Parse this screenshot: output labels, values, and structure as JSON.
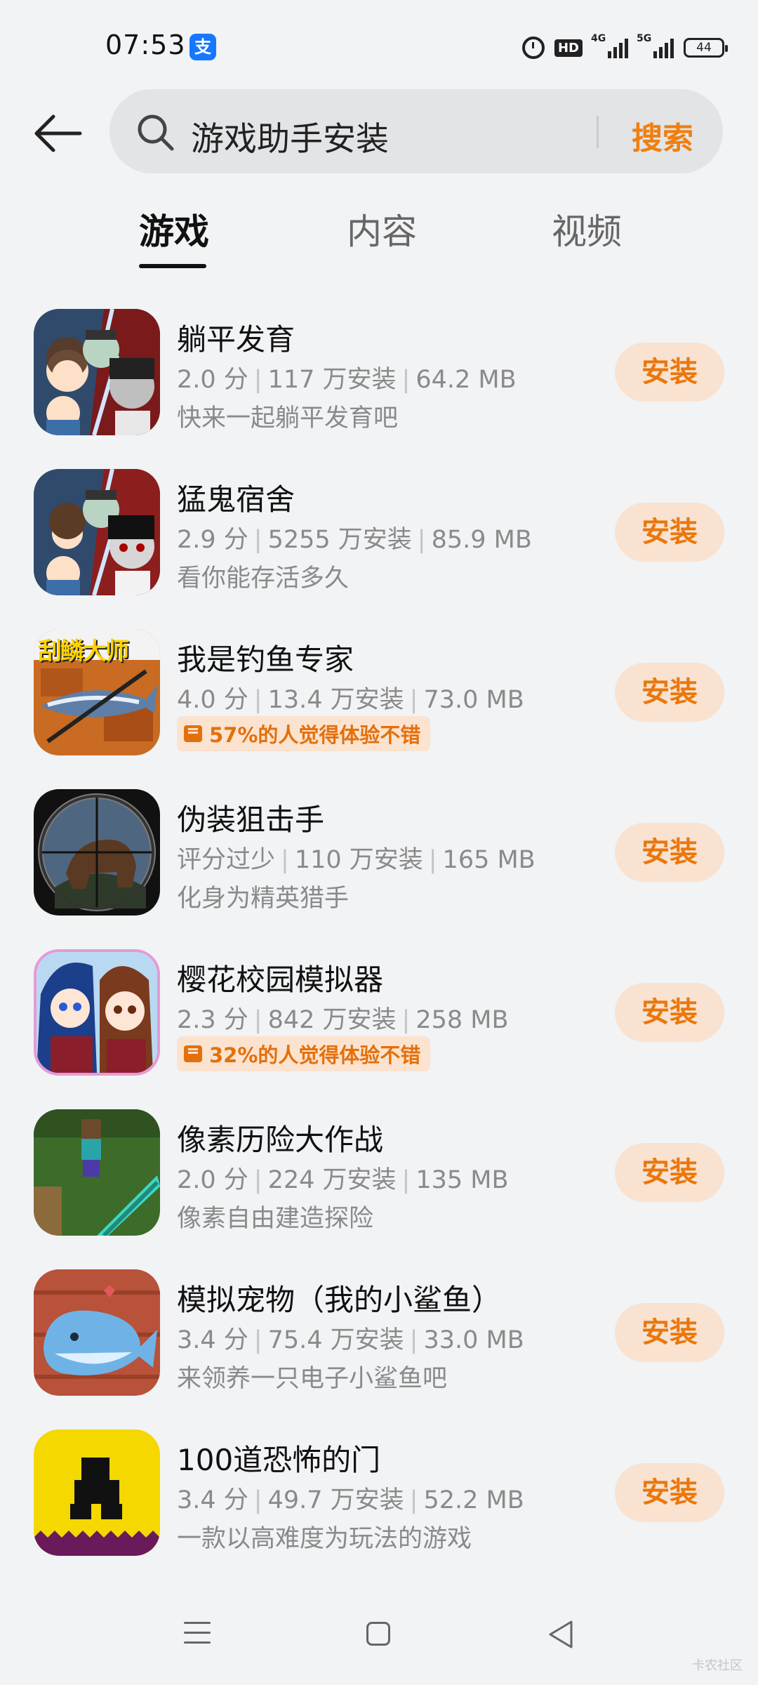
{
  "status_bar": {
    "time": "07:53",
    "app_icon_char": "支",
    "hd_label": "HD",
    "signal_4g": "4G",
    "signal_5g": "5G",
    "battery": "44"
  },
  "search": {
    "query": "游戏助手安装",
    "button_label": "搜索"
  },
  "tabs": [
    {
      "label": "游戏",
      "active": true
    },
    {
      "label": "内容",
      "active": false
    },
    {
      "label": "视频",
      "active": false
    }
  ],
  "apps": [
    {
      "title": "躺平发育",
      "rating": "2.0 分",
      "installs": "117 万安装",
      "size": "64.2 MB",
      "desc": "快来一起躺平发育吧",
      "badge": "",
      "button": "安装",
      "icon": "cartoon-family-icon"
    },
    {
      "title": "猛鬼宿舍",
      "rating": "2.9 分",
      "installs": "5255 万安装",
      "size": "85.9 MB",
      "desc": "看你能存活多久",
      "badge": "",
      "button": "安装",
      "icon": "cartoon-ghost-icon"
    },
    {
      "title": "我是钓鱼专家",
      "rating": "4.0 分",
      "installs": "13.4 万安装",
      "size": "73.0 MB",
      "desc": "",
      "badge": "57%的人觉得体验不错",
      "button": "安装",
      "icon": "fish-master-icon",
      "icon_text": "刮鳞大师"
    },
    {
      "title": "伪装狙击手",
      "rating": "评分过少",
      "installs": "110 万安装",
      "size": "165 MB",
      "desc": "化身为精英猎手",
      "badge": "",
      "button": "安装",
      "icon": "sniper-scope-icon"
    },
    {
      "title": "樱花校园模拟器",
      "rating": "2.3 分",
      "installs": "842 万安装",
      "size": "258 MB",
      "desc": "",
      "badge": "32%的人觉得体验不错",
      "button": "安装",
      "icon": "anime-girls-icon"
    },
    {
      "title": "像素历险大作战",
      "rating": "2.0 分",
      "installs": "224 万安装",
      "size": "135 MB",
      "desc": "像素自由建造探险",
      "badge": "",
      "button": "安装",
      "icon": "pixel-sword-icon"
    },
    {
      "title": "模拟宠物（我的小鲨鱼）",
      "rating": "3.4 分",
      "installs": "75.4 万安装",
      "size": "33.0 MB",
      "desc": "来领养一只电子小鲨鱼吧",
      "badge": "",
      "button": "安装",
      "icon": "pixel-shark-icon"
    },
    {
      "title": "100道恐怖的门",
      "rating": "3.4 分",
      "installs": "49.7 万安装",
      "size": "52.2 MB",
      "desc": "一款以高难度为玩法的游戏",
      "badge": "",
      "button": "安装",
      "icon": "scary-door-icon"
    }
  ],
  "watermark": "卡农社区",
  "colors": {
    "accent": "#f07f0f",
    "install_bg": "#f9e2cf",
    "background": "#f1f3f5"
  }
}
